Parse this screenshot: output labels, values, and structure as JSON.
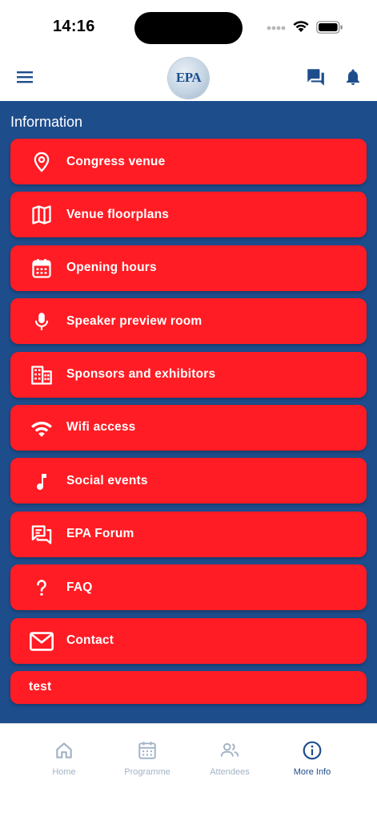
{
  "status_bar": {
    "time": "14:16"
  },
  "header": {
    "menu_icon": "hamburger-icon",
    "logo_text": "EPA",
    "chat_icon": "chat-icon",
    "bell_icon": "bell-icon"
  },
  "section": {
    "title": "Information"
  },
  "menu": {
    "items": [
      {
        "label": "Congress venue",
        "icon": "location-pin-icon"
      },
      {
        "label": "Venue floorplans",
        "icon": "map-icon"
      },
      {
        "label": "Opening hours",
        "icon": "calendar-icon"
      },
      {
        "label": "Speaker preview room",
        "icon": "microphone-icon"
      },
      {
        "label": "Sponsors and exhibitors",
        "icon": "building-icon"
      },
      {
        "label": "Wifi access",
        "icon": "wifi-icon"
      },
      {
        "label": "Social events",
        "icon": "music-note-icon"
      },
      {
        "label": "EPA Forum",
        "icon": "forum-icon"
      },
      {
        "label": "FAQ",
        "icon": "question-mark-icon"
      },
      {
        "label": "Contact",
        "icon": "mail-icon"
      },
      {
        "label": "test",
        "icon": ""
      }
    ]
  },
  "tabbar": {
    "tabs": [
      {
        "label": "Home",
        "icon": "home-icon",
        "active": false
      },
      {
        "label": "Programme",
        "icon": "calendar-icon",
        "active": false
      },
      {
        "label": "Attendees",
        "icon": "people-icon",
        "active": false
      },
      {
        "label": "More Info",
        "icon": "info-icon",
        "active": true
      }
    ]
  },
  "colors": {
    "primary": "#1e4d8c",
    "menu_item": "#ff1c24",
    "tab_inactive": "#a3b3c6"
  }
}
